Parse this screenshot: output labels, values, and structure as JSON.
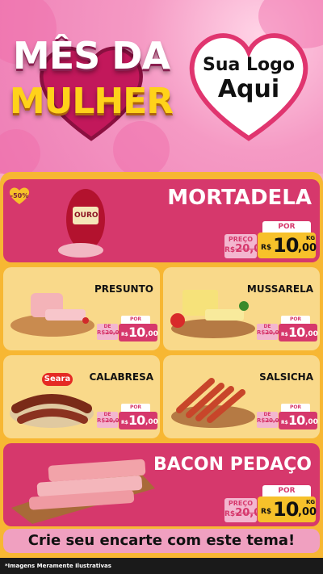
{
  "header": {
    "title_line1": "MÊS DA",
    "title_line2": "MULHER",
    "logo_line1": "Sua Logo",
    "logo_line2": "Aqui"
  },
  "featured": [
    {
      "name": "MORTADELA",
      "badge": "-50%",
      "brand": "OURO",
      "price_de_label": "PREÇO",
      "price_old": "20,00",
      "price_old_currency": "R$",
      "price_por_label": "POR",
      "price_currency": "R$",
      "price_int": "10",
      "price_cents": ",00",
      "unit": "KG"
    },
    {
      "name": "BACON PEDAÇO",
      "price_de_label": "PREÇO",
      "price_old": "20,00",
      "price_old_currency": "R$",
      "price_por_label": "POR",
      "price_currency": "R$",
      "price_int": "10",
      "price_cents": ",00",
      "unit": "KG"
    }
  ],
  "products": [
    {
      "name": "PRESUNTO",
      "de_label": "DE",
      "old": "20,00",
      "old_currency": "R$",
      "por_label": "POR",
      "currency": "R$",
      "int": "10",
      "cents": ",00"
    },
    {
      "name": "MUSSARELA",
      "de_label": "DE",
      "old": "20,00",
      "old_currency": "R$",
      "por_label": "POR",
      "currency": "R$",
      "int": "10",
      "cents": ",00"
    },
    {
      "name": "CALABRESA",
      "brand": "Seara",
      "de_label": "DE",
      "old": "20,00",
      "old_currency": "R$",
      "por_label": "POR",
      "currency": "R$",
      "int": "10",
      "cents": ",00"
    },
    {
      "name": "SALSICHA",
      "de_label": "DE",
      "old": "20,00",
      "old_currency": "R$",
      "por_label": "POR",
      "currency": "R$",
      "int": "10",
      "cents": ",00"
    }
  ],
  "cta": "Crie seu encarte com este tema!",
  "footnote": "*Imagens Meramente Ilustrativas",
  "colors": {
    "pink": "#d6386c",
    "yellow": "#f7b733",
    "cream": "#f9d98a"
  }
}
